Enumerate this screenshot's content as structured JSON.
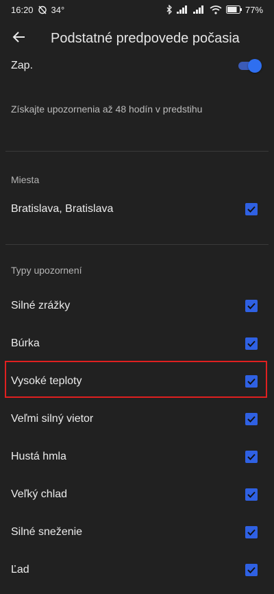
{
  "status_bar": {
    "time": "16:20",
    "temperature": "34°",
    "battery": "77"
  },
  "app_bar": {
    "title": "Podstatné predpovede počasia"
  },
  "toggle_row": {
    "label": "Zap.",
    "state": "on",
    "description": "Získajte upozornenia až 48 hodín v predstihu"
  },
  "places": {
    "header": "Miesta",
    "items": [
      {
        "label": "Bratislava, Bratislava",
        "checked": true
      }
    ]
  },
  "alert_types": {
    "header": "Typy upozornení",
    "items": [
      {
        "label": "Silné zrážky",
        "checked": true
      },
      {
        "label": "Búrka",
        "checked": true
      },
      {
        "label": "Vysoké teploty",
        "checked": true,
        "highlighted": true
      },
      {
        "label": "Veľmi silný vietor",
        "checked": true
      },
      {
        "label": "Hustá hmla",
        "checked": true
      },
      {
        "label": "Veľký chlad",
        "checked": true
      },
      {
        "label": "Silné sneženie",
        "checked": true
      },
      {
        "label": "Ľad",
        "checked": true
      }
    ]
  },
  "colors": {
    "background": "#212121",
    "accent": "#2f61e3",
    "highlight": "#e02020"
  }
}
